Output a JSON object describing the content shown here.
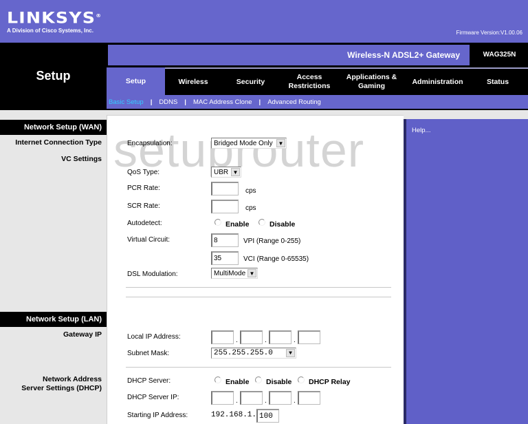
{
  "brand": {
    "name": "LINKSYS",
    "registered": "®",
    "tagline": "A Division of Cisco Systems, Inc."
  },
  "firmware": "Firmware Version:V1.00.06",
  "page_title": "Setup",
  "product_name": "Wireless-N ADSL2+ Gateway",
  "model": "WAG325N",
  "tabs": [
    {
      "label": "Setup",
      "active": true
    },
    {
      "label": "Wireless"
    },
    {
      "label": "Security"
    },
    {
      "label": "Access Restrictions"
    },
    {
      "label": "Applications & Gaming"
    },
    {
      "label": "Administration"
    },
    {
      "label": "Status"
    }
  ],
  "subnav": [
    {
      "label": "Basic Setup",
      "active": true
    },
    {
      "label": "DDNS"
    },
    {
      "label": "MAC Address Clone"
    },
    {
      "label": "Advanced Routing"
    }
  ],
  "sidebar": {
    "wan_header": "Network Setup (WAN)",
    "internet_connection_type": "Internet Connection Type",
    "vc_settings": "VC Settings",
    "lan_header": "Network Setup (LAN)",
    "gateway_ip": "Gateway IP",
    "dhcp_line1": "Network Address",
    "dhcp_line2": "Server Settings (DHCP)"
  },
  "watermark": "setuprouter",
  "wan": {
    "encapsulation": {
      "label": "Encapsulation:",
      "value": "Bridged Mode Only"
    },
    "qos_type": {
      "label": "QoS Type:",
      "value": "UBR"
    },
    "pcr_rate": {
      "label": "PCR Rate:",
      "value": "",
      "unit": "cps"
    },
    "scr_rate": {
      "label": "SCR Rate:",
      "value": "",
      "unit": "cps"
    },
    "autodetect": {
      "label": "Autodetect:",
      "options": [
        "Enable",
        "Disable"
      ]
    },
    "virtual_circuit": {
      "label": "Virtual Circuit:",
      "vpi": {
        "value": "8",
        "hint": "VPI (Range 0-255)"
      },
      "vci": {
        "value": "35",
        "hint": "VCI (Range 0-65535)"
      }
    },
    "dsl_modulation": {
      "label": "DSL Modulation:",
      "value": "MultiMode"
    }
  },
  "lan": {
    "local_ip": {
      "label": "Local IP Address:",
      "octets": [
        "",
        "",
        "",
        ""
      ]
    },
    "subnet_mask": {
      "label": "Subnet Mask:",
      "value": "255.255.255.0"
    },
    "dhcp_server": {
      "label": "DHCP Server:",
      "options": [
        "Enable",
        "Disable",
        "DHCP Relay"
      ]
    },
    "dhcp_server_ip": {
      "label": "DHCP Server IP:",
      "octets": [
        "",
        "",
        "",
        ""
      ]
    },
    "starting_ip": {
      "label": "Starting IP Address:",
      "prefix": "192.168.1.",
      "value": "100"
    }
  },
  "help": {
    "label": "Help..."
  }
}
